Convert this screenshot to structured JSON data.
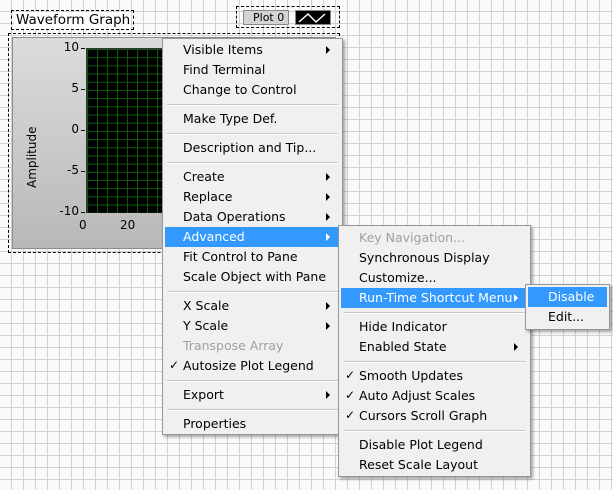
{
  "graph": {
    "title": "Waveform Graph",
    "legend_label": "Plot 0",
    "y_axis_label": "Amplitude",
    "y_ticks": [
      "10",
      "5",
      "0",
      "-5",
      "-10"
    ],
    "x_ticks": [
      "0",
      "20"
    ],
    "plot_bg": "#000000",
    "grid_color": "#0d5c0d"
  },
  "main_menu": {
    "items": [
      {
        "label": "Visible Items",
        "submenu": true
      },
      {
        "label": "Find Terminal"
      },
      {
        "label": "Change to Control"
      },
      {
        "label": "Make Type Def."
      },
      {
        "label": "Description and Tip..."
      },
      {
        "label": "Create",
        "submenu": true
      },
      {
        "label": "Replace",
        "submenu": true
      },
      {
        "label": "Data Operations",
        "submenu": true
      },
      {
        "label": "Advanced",
        "submenu": true,
        "highlighted": true
      },
      {
        "label": "Fit Control to Pane"
      },
      {
        "label": "Scale Object with Pane"
      },
      {
        "label": "X Scale",
        "submenu": true
      },
      {
        "label": "Y Scale",
        "submenu": true
      },
      {
        "label": "Transpose Array",
        "disabled": true
      },
      {
        "label": "Autosize Plot Legend",
        "checked": true
      },
      {
        "label": "Export",
        "submenu": true
      },
      {
        "label": "Properties"
      }
    ]
  },
  "advanced_menu": {
    "items": [
      {
        "label": "Key Navigation...",
        "disabled": true
      },
      {
        "label": "Synchronous Display"
      },
      {
        "label": "Customize..."
      },
      {
        "label": "Run-Time Shortcut Menu",
        "submenu": true,
        "highlighted": true
      },
      {
        "label": "Hide Indicator"
      },
      {
        "label": "Enabled State",
        "submenu": true
      },
      {
        "label": "Smooth Updates",
        "checked": true
      },
      {
        "label": "Auto Adjust Scales",
        "checked": true
      },
      {
        "label": "Cursors Scroll Graph",
        "checked": true
      },
      {
        "label": "Disable Plot Legend"
      },
      {
        "label": "Reset Scale Layout"
      }
    ]
  },
  "runtime_menu": {
    "items": [
      {
        "label": "Disable",
        "highlighted": true
      },
      {
        "label": "Edit..."
      }
    ]
  },
  "colors": {
    "highlight": "#3399ff",
    "menu_bg": "#f0f0f0",
    "disabled_text": "#a0a0a0"
  },
  "check_glyph": "✓"
}
